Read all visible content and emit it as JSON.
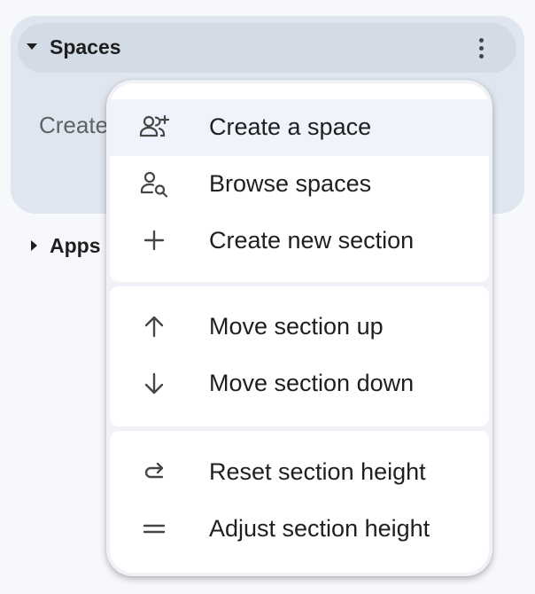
{
  "sidebar": {
    "spaces_section": {
      "title": "Spaces",
      "truncated_item": "Create"
    },
    "apps_section": {
      "title": "Apps"
    }
  },
  "menu": {
    "groups": [
      {
        "items": [
          {
            "label": "Create a space",
            "icon": "add-person-icon",
            "highlighted": true
          },
          {
            "label": "Browse spaces",
            "icon": "search-people-icon",
            "highlighted": false
          },
          {
            "label": "Create new section",
            "icon": "plus-icon",
            "highlighted": false
          }
        ]
      },
      {
        "items": [
          {
            "label": "Move section up",
            "icon": "arrow-up-icon",
            "highlighted": false
          },
          {
            "label": "Move section down",
            "icon": "arrow-down-icon",
            "highlighted": false
          }
        ]
      },
      {
        "items": [
          {
            "label": "Reset section height",
            "icon": "reset-arrow-icon",
            "highlighted": false
          },
          {
            "label": "Adjust section height",
            "icon": "equals-icon",
            "highlighted": false
          }
        ]
      }
    ]
  },
  "colors": {
    "background": "#f6f8fc",
    "panel": "#dfe6ef",
    "header": "#d2dbe6",
    "menu_surface": "#ffffff",
    "highlight": "#eef3fc",
    "text": "#1f1f1f",
    "icon": "#444746"
  }
}
